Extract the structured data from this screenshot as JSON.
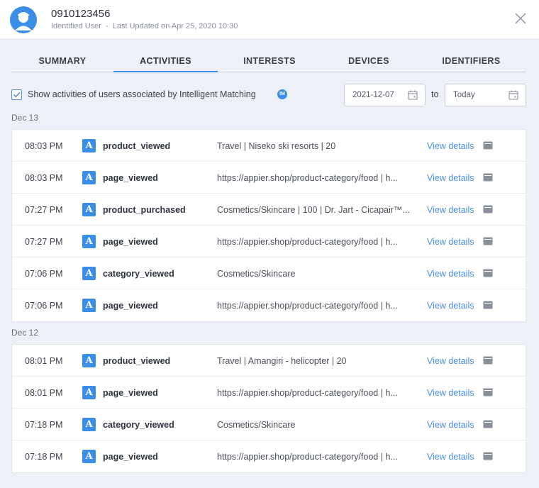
{
  "header": {
    "user_id": "0910123456",
    "user_type": "Identified User",
    "separator": "-",
    "last_updated": "Last Updated on Apr 25, 2020 10:30"
  },
  "tabs": [
    {
      "label": "SUMMARY",
      "active": false
    },
    {
      "label": "ACTIVITIES",
      "active": true
    },
    {
      "label": "INTERESTS",
      "active": false
    },
    {
      "label": "DEVICES",
      "active": false
    },
    {
      "label": "IDENTIFIERS",
      "active": false
    }
  ],
  "filter": {
    "checkbox_checked": true,
    "checkbox_label": "Show activities of users associated by Intelligent Matching",
    "im_badge": "IM",
    "date_from": "2021-12-07",
    "to_label": "to",
    "date_to": "Today"
  },
  "days": [
    {
      "label": "Dec 13",
      "rows": [
        {
          "time": "08:03 PM",
          "icon": "A",
          "event": "product_viewed",
          "detail": "Travel | Niseko ski resorts | 20",
          "link": "View details"
        },
        {
          "time": "08:03 PM",
          "icon": "A",
          "event": "page_viewed",
          "detail": "https://appier.shop/product-category/food | h...",
          "link": "View details"
        },
        {
          "time": "07:27 PM",
          "icon": "A",
          "event": "product_purchased",
          "detail": "Cosmetics/Skincare | 100 | Dr. Jart - Cicapair™...",
          "link": "View details"
        },
        {
          "time": "07:27 PM",
          "icon": "A",
          "event": "page_viewed",
          "detail": "https://appier.shop/product-category/food | h...",
          "link": "View details"
        },
        {
          "time": "07:06 PM",
          "icon": "A",
          "event": "category_viewed",
          "detail": "Cosmetics/Skincare",
          "link": "View details"
        },
        {
          "time": "07:06 PM",
          "icon": "A",
          "event": "page_viewed",
          "detail": "https://appier.shop/product-category/food | h...",
          "link": "View details"
        }
      ]
    },
    {
      "label": "Dec 12",
      "rows": [
        {
          "time": "08:01 PM",
          "icon": "A",
          "event": "product_viewed",
          "detail": "Travel | Amangiri - helicopter | 20",
          "link": "View details"
        },
        {
          "time": "08:01 PM",
          "icon": "A",
          "event": "page_viewed",
          "detail": "https://appier.shop/product-category/food | h...",
          "link": "View details"
        },
        {
          "time": "07:18 PM",
          "icon": "A",
          "event": "category_viewed",
          "detail": "Cosmetics/Skincare",
          "link": "View details"
        },
        {
          "time": "07:18 PM",
          "icon": "A",
          "event": "page_viewed",
          "detail": "https://appier.shop/product-category/food | h...",
          "link": "View details"
        }
      ]
    }
  ],
  "colors": {
    "accent": "#3a8ee6",
    "link": "#4a90e2",
    "background": "#eef0f7"
  }
}
